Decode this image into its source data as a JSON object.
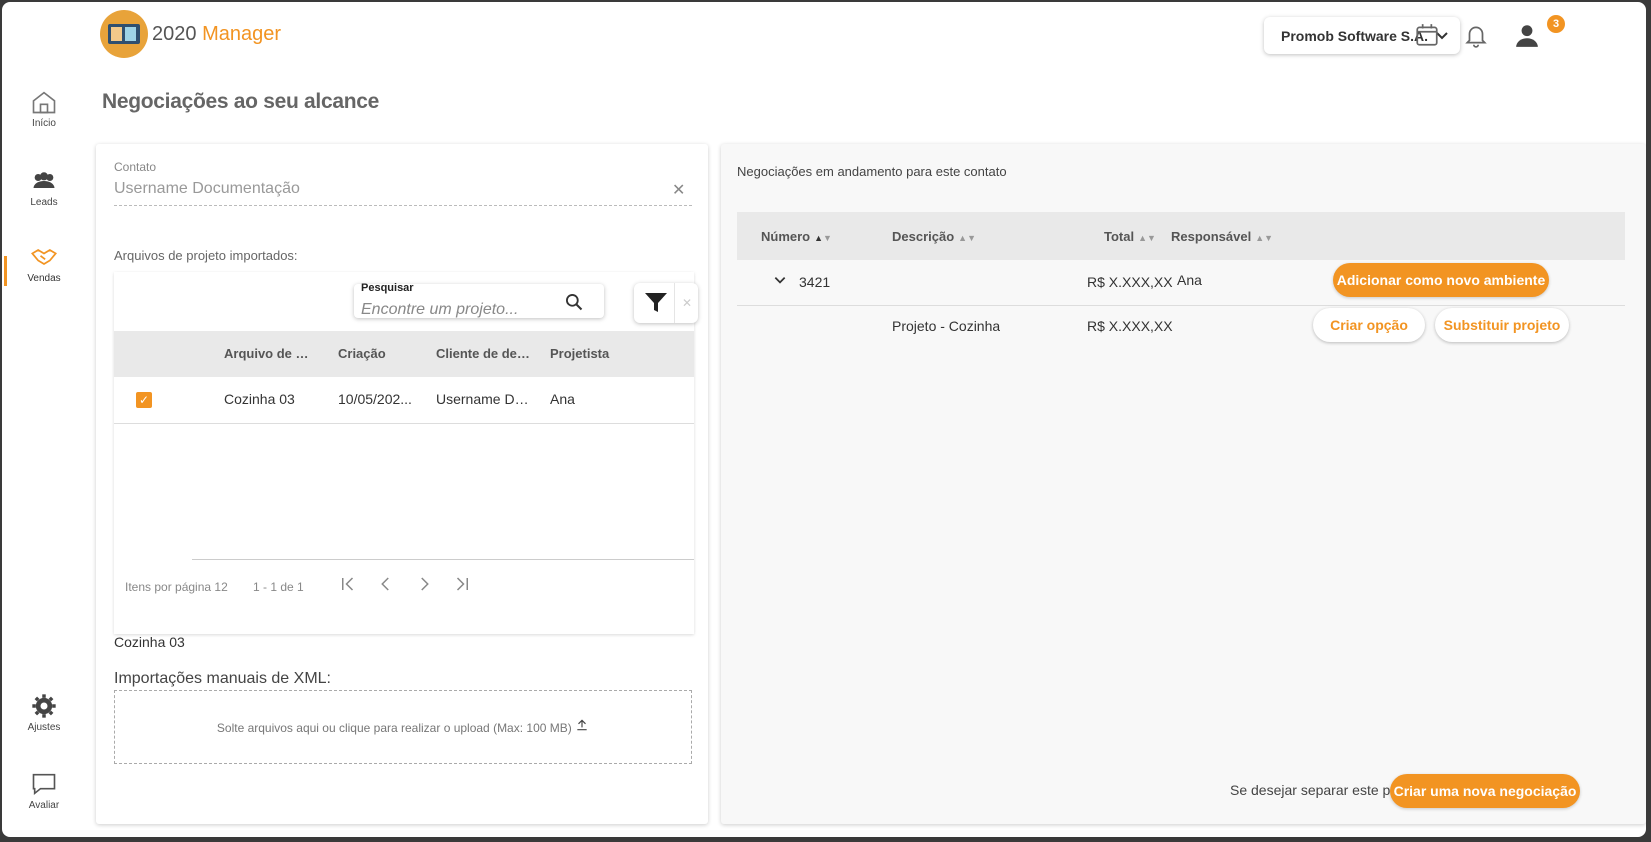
{
  "app": {
    "logo_prefix": "2020",
    "logo_suffix": "Manager",
    "company": "Promob Software S.A.",
    "notification_count": "3",
    "accent_color": "#f29422"
  },
  "sidebar": {
    "items": [
      {
        "label": "Início",
        "icon": "house-icon"
      },
      {
        "label": "Leads",
        "icon": "people-icon"
      },
      {
        "label": "Vendas",
        "icon": "handshake-icon",
        "active": true
      },
      {
        "label": "Ajustes",
        "icon": "gear-icon"
      },
      {
        "label": "Avaliar",
        "icon": "chat-icon"
      }
    ]
  },
  "page": {
    "title": "Negociações ao seu alcance"
  },
  "left": {
    "contact_label": "Contato",
    "contact_value": "Username Documentação",
    "files_label": "Arquivos de projeto importados:",
    "search_label": "Pesquisar",
    "search_placeholder": "Encontre um projeto...",
    "columns": [
      "Arquivo de orç...",
      "Criação",
      "Cliente de desi...",
      "Projetista"
    ],
    "rows": [
      {
        "checked": true,
        "file": "Cozinha 03",
        "created": "10/05/202...",
        "client": "Username Do...",
        "designer": "Ana"
      }
    ],
    "items_per_page": "Itens por página 12",
    "range": "1 - 1 de 1",
    "selected_name": "Cozinha 03",
    "xml_label": "Importações manuais de XML:",
    "dropzone_text": "Solte arquivos aqui ou clique para realizar o upload (Max: 100 MB)"
  },
  "right": {
    "heading": "Negociações em andamento para este contato",
    "columns": [
      "Número",
      "Descrição",
      "Total",
      "Responsável"
    ],
    "row1": {
      "number": "3421",
      "total": "R$ X.XXX,XX",
      "responsible": "Ana",
      "action": "Adicionar como novo ambiente"
    },
    "row2": {
      "description": "Projeto - Cozinha",
      "total": "R$ X.XXX,XX",
      "action_option": "Criar opção",
      "action_replace": "Substituir projeto"
    },
    "separate_text": "Se desejar separar este projeto",
    "new_negotiation": "Criar uma nova negociação"
  }
}
